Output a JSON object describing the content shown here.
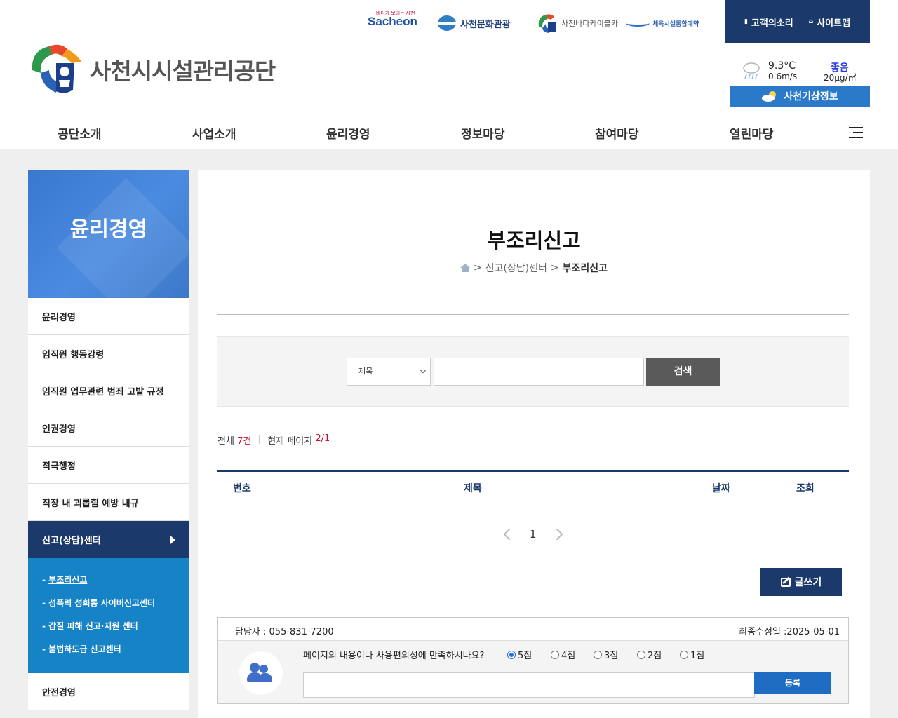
{
  "header": {
    "org_name": "사천시시설관리공단",
    "partners": {
      "sachen": "Sacheon",
      "sachen_tagline": "바다가 보이는 사천",
      "culture": "사천문화관광",
      "cablecar": "사천바다케이블카",
      "sports": "체육시설통합예약"
    },
    "toplinks": {
      "voice": "고객의소리",
      "sitemap": "사이트맵"
    },
    "weather": {
      "temp": "9.3°C",
      "wind": "0.6m/s",
      "air_status": "좋음",
      "pm": "20μg/㎥",
      "button": "사천기상정보"
    }
  },
  "gnb": {
    "items": [
      "공단소개",
      "사업소개",
      "윤리경영",
      "정보마당",
      "참여마당",
      "열린마당"
    ]
  },
  "lnb": {
    "title": "윤리경영",
    "items": [
      "윤리경영",
      "임직원 행동강령",
      "임직원 업무관련 범죄 고발 규정",
      "인권경영",
      "적극행정",
      "직장 내 괴롭힘 예방 내규"
    ],
    "active": "신고(상담)센터",
    "sub": [
      "부조리신고",
      "성폭력 성희롱 사이버신고센터",
      "갑질 피해 신고·지원 센터",
      "불법하도급 신고센터"
    ],
    "after": "안전경영"
  },
  "main": {
    "title": "부조리신고",
    "breadcrumb": {
      "sep1": ">",
      "parent": "신고(상담)센터",
      "sep2": ">",
      "current": "부조리신고"
    },
    "search": {
      "select": "제목",
      "button": "검색"
    },
    "count": {
      "total_label": "전체",
      "total": "7건",
      "page_label": "현재 페이지",
      "page": "2/1"
    },
    "table_headers": [
      "번호",
      "제목",
      "날짜",
      "조회"
    ],
    "paging": {
      "current": "1"
    },
    "write_button": "글쓰기"
  },
  "survey": {
    "manager": "담당자 : 055-831-7200",
    "updated": "최종수정일 :2025-05-01",
    "question": "페이지의 내용이나 사용편의성에 만족하시나요?",
    "options": [
      "5점",
      "4점",
      "3점",
      "2점",
      "1점"
    ],
    "selected": "5점",
    "submit": "등록"
  },
  "colors": {
    "navy": "#1b3a6b",
    "blue": "#1783c7",
    "accent_red": "#c8102e"
  }
}
